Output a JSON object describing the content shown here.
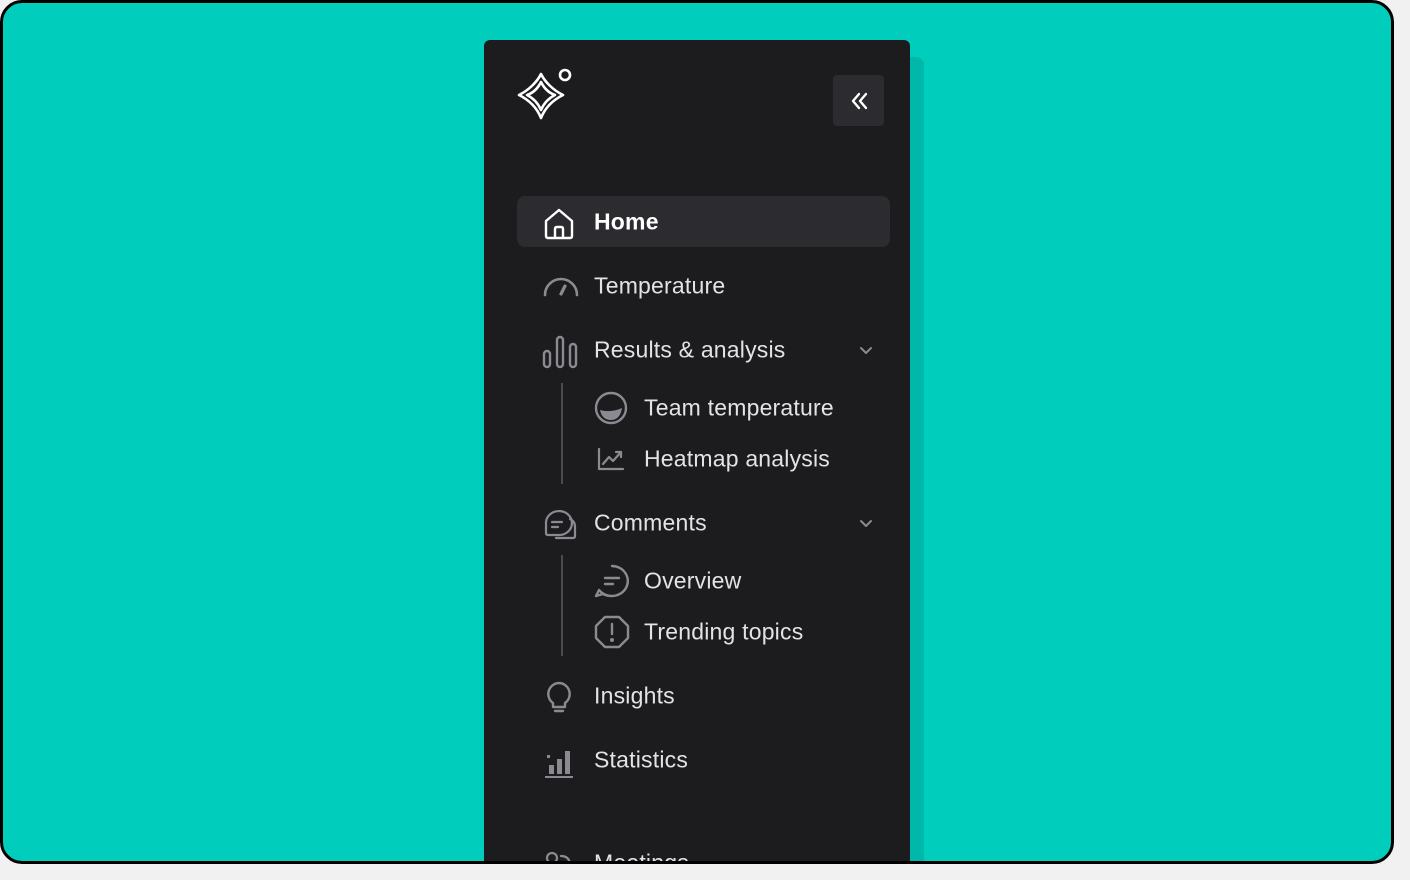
{
  "sidebar": {
    "collapse_label": "collapse-sidebar",
    "nav": {
      "home": "Home",
      "temperature": "Temperature",
      "results": "Results & analysis",
      "team_temperature": "Team temperature",
      "heatmap": "Heatmap analysis",
      "comments": "Comments",
      "overview": "Overview",
      "trending": "Trending topics",
      "insights": "Insights",
      "statistics": "Statistics",
      "meetings": "Meetings"
    }
  },
  "colors": {
    "background": "#00cdbc",
    "sidebar": "#1c1c1f",
    "active_item": "#2c2c30",
    "text": "#e3e3e6",
    "icon": "#8a8a90"
  }
}
